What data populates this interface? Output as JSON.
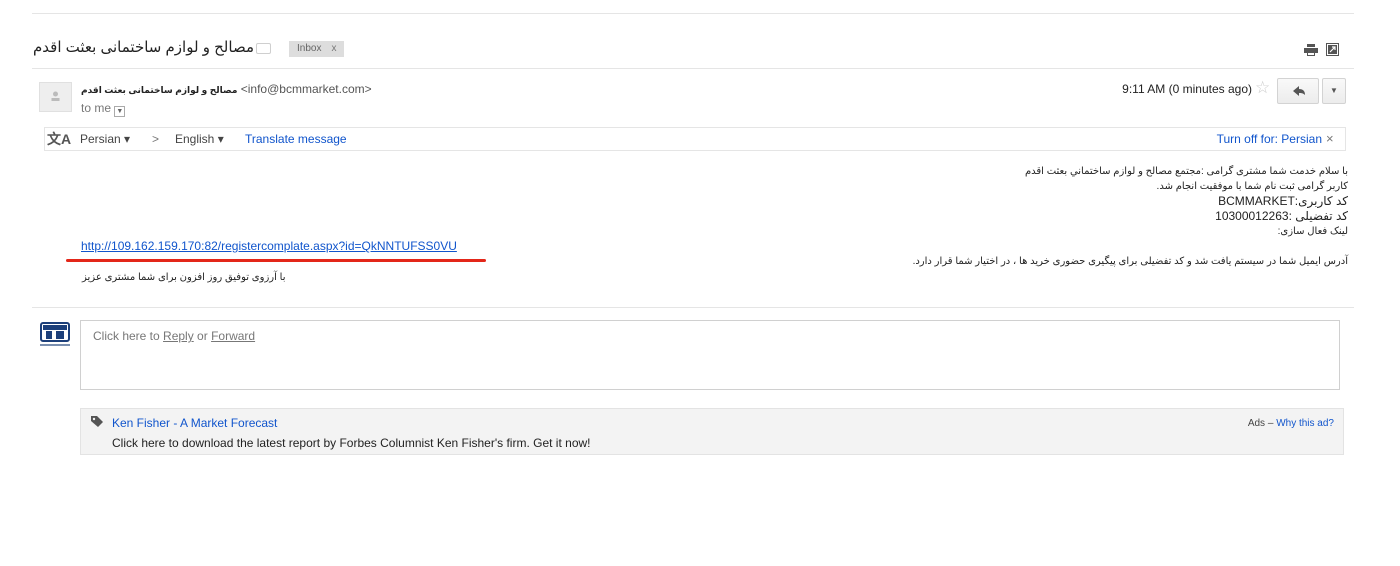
{
  "header": {
    "subject": "مصالح و لوازم ساختمانی بعثت اقدم",
    "label_chip": "Inbox",
    "label_close": "x"
  },
  "message": {
    "sender_name": "مصالح و لوازم ساختمانی بعثت اقدم",
    "sender_email": "<info@bcmmarket.com>",
    "recipient": "to me",
    "time": "9:11 AM (0 minutes ago)",
    "star": "☆",
    "more": "▼"
  },
  "translate_bar": {
    "source_lang": "Persian ▾",
    "arrow": ">",
    "target_lang": "English ▾",
    "translate_link": "Translate message",
    "turn_off": "Turn off for: Persian",
    "close": "×",
    "icon_glyph": "文A"
  },
  "body": {
    "line1": "با سلام خدمت شما مشتری گرامی :مجتمع مصالح و لوازم ساختماني بعثت اقدم",
    "line2": "کاربر گرامی ثبت نام شما با موفقيت انجام شد.",
    "line3": "کد کاربری:BCMMARKET",
    "line4": "کد تفضيلی :10300012263",
    "line5": "لينک فعال سازی:",
    "link": "http://109.162.159.170:82/registercomplate.aspx?id=QkNNTUFSS0VU",
    "line6": "آدرس ايميل شما در سيستم يافت شد و کد تفضيلی برای پيگيری حضوری خريد ها ، در اختيار شما قرار دارد.",
    "line7": "با آرزوی توفيق روز افزون برای شما مشتری عزيز"
  },
  "reply": {
    "prefix": "Click here to ",
    "reply_link": "Reply",
    "or": " or ",
    "forward_link": "Forward"
  },
  "ad": {
    "title": "Ken Fisher - A Market Forecast",
    "description": "Click here to download the latest report by Forbes Columnist Ken Fisher's firm. Get it now!",
    "ads_label": "Ads – ",
    "why_link": "Why this ad?"
  },
  "colors": {
    "link": "#1155cc",
    "underline_annotation": "#e32619"
  }
}
